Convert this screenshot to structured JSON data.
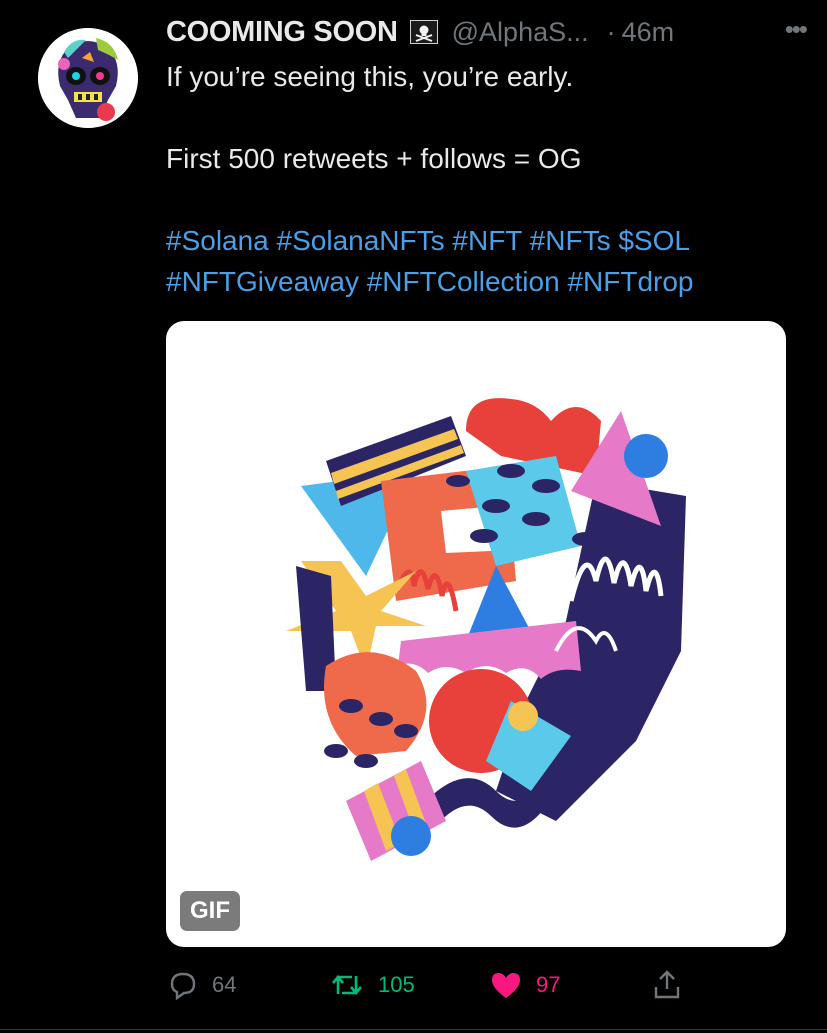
{
  "tweet": {
    "author_name": "COOMING SOON",
    "handle": "@AlphaS...",
    "separator": "·",
    "time": "46m",
    "more_label": "•••",
    "text_line1": "If you’re seeing this, you’re early.",
    "text_line2": "First 500 retweets + follows = OG",
    "hashtags_line1": "#Solana #SolanaNFTs #NFT #NFTs $SOL",
    "hashtags_line2": "#NFTGiveaway #NFTCollection #NFTdrop",
    "media_badge": "GIF"
  },
  "actions": {
    "replies": "64",
    "retweets": "105",
    "likes": "97"
  },
  "colors": {
    "background": "#000000",
    "text": "#e7e9ea",
    "muted": "#71767b",
    "link": "#4b9fe6",
    "retweet_green": "#00ba7c",
    "like_pink": "#f91880"
  },
  "icons": [
    "pirate-flag-icon",
    "more-icon",
    "reply-icon",
    "retweet-icon",
    "heart-icon",
    "share-icon"
  ]
}
